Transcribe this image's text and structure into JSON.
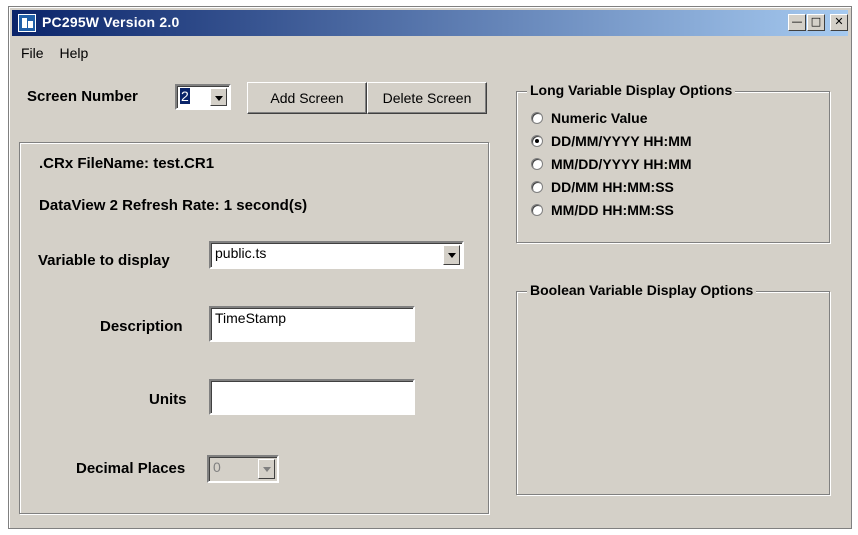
{
  "window": {
    "title": "PC295W Version 2.0"
  },
  "menu": [
    {
      "label": "File"
    },
    {
      "label": "Help"
    }
  ],
  "screen": {
    "label": "Screen Number",
    "value": "2",
    "add_label": "Add Screen",
    "delete_label": "Delete Screen"
  },
  "details": {
    "filename": ".CRx FileName: test.CR1",
    "refresh": "DataView 2 Refresh Rate: 1 second(s)",
    "variable_label": "Variable to display",
    "variable_value": "public.ts",
    "description_label": "Description",
    "description_value": "TimeStamp",
    "units_label": "Units",
    "units_value": "",
    "decimal_label": "Decimal Places",
    "decimal_value": "0"
  },
  "long_options": {
    "title": "Long Variable Display Options",
    "options": [
      {
        "label": "Numeric Value",
        "selected": false
      },
      {
        "label": "DD/MM/YYYY HH:MM",
        "selected": true
      },
      {
        "label": "MM/DD/YYYY HH:MM",
        "selected": false
      },
      {
        "label": "DD/MM HH:MM:SS",
        "selected": false
      },
      {
        "label": "MM/DD HH:MM:SS",
        "selected": false
      }
    ]
  },
  "boolean_options": {
    "title": "Boolean Variable Display Options"
  },
  "colors": {
    "titlebar_start": "#0a246a",
    "titlebar_end": "#a6caf0",
    "face": "#d4d0c8"
  }
}
